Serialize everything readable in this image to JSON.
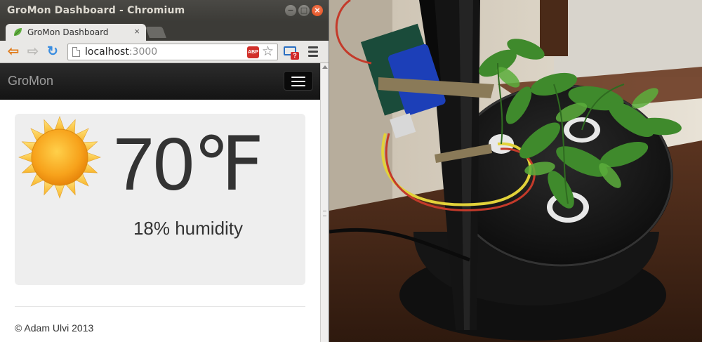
{
  "window": {
    "title": "GroMon Dashboard - Chromium",
    "buttons": {
      "minimize": "−",
      "maximize": "□",
      "close": "×"
    }
  },
  "tab": {
    "label": "GroMon Dashboard",
    "close": "×",
    "favicon": "leaf-icon"
  },
  "toolbar": {
    "back_icon": "back-arrow-icon",
    "forward_icon": "forward-arrow-icon",
    "reload_icon": "reload-icon",
    "url_host": "localhost",
    "url_port": ":3000",
    "adblock_label": "ABP",
    "bookmark_icon": "star-icon",
    "extension_badge": "?",
    "menu_icon": "hamburger-menu-icon"
  },
  "page": {
    "brand": "GroMon",
    "weather_icon": "sun-icon",
    "temperature": "70℉",
    "humidity": "18% humidity",
    "footer": "© Adam Ulvi 2013"
  },
  "photo": {
    "subject": "hydroponic planter with tomato seedlings and attached sensor board"
  },
  "colors": {
    "navbar": "#222222",
    "panel": "#eeeeee",
    "sun": "#f7a21b",
    "text": "#333333"
  }
}
